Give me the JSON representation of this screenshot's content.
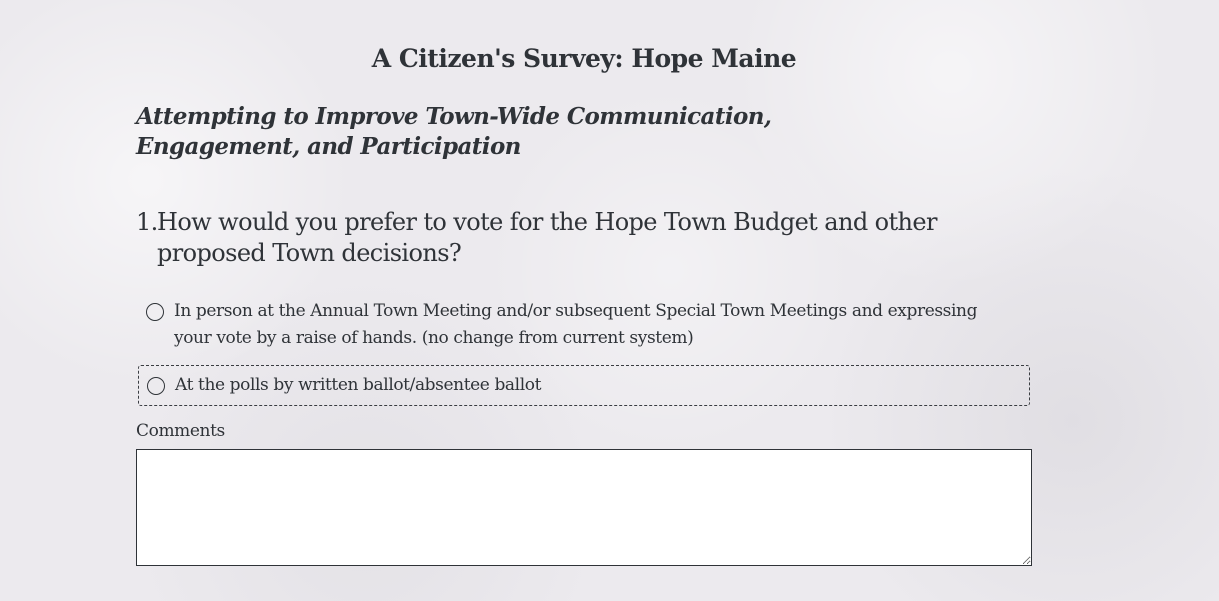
{
  "survey": {
    "title": "A Citizen's Survey: Hope Maine",
    "subtitle": "Attempting to Improve Town-Wide Communication, Engagement, and Participation"
  },
  "question": {
    "number": "1.",
    "text": "How would you prefer to vote for the Hope Town Budget and other proposed Town decisions?",
    "choices": [
      {
        "label": "In person at the Annual Town Meeting and/or subsequent Special Town Meetings and expressing your vote by a raise of hands. (no change from current system)",
        "selected": false
      },
      {
        "label": "At the polls by written ballot/absentee ballot",
        "selected": false,
        "focused": true
      }
    ],
    "comments_label": "Comments",
    "comments_value": ""
  },
  "colors": {
    "background": "#eceaee",
    "text": "#2f3338",
    "input_background": "#ffffff"
  }
}
